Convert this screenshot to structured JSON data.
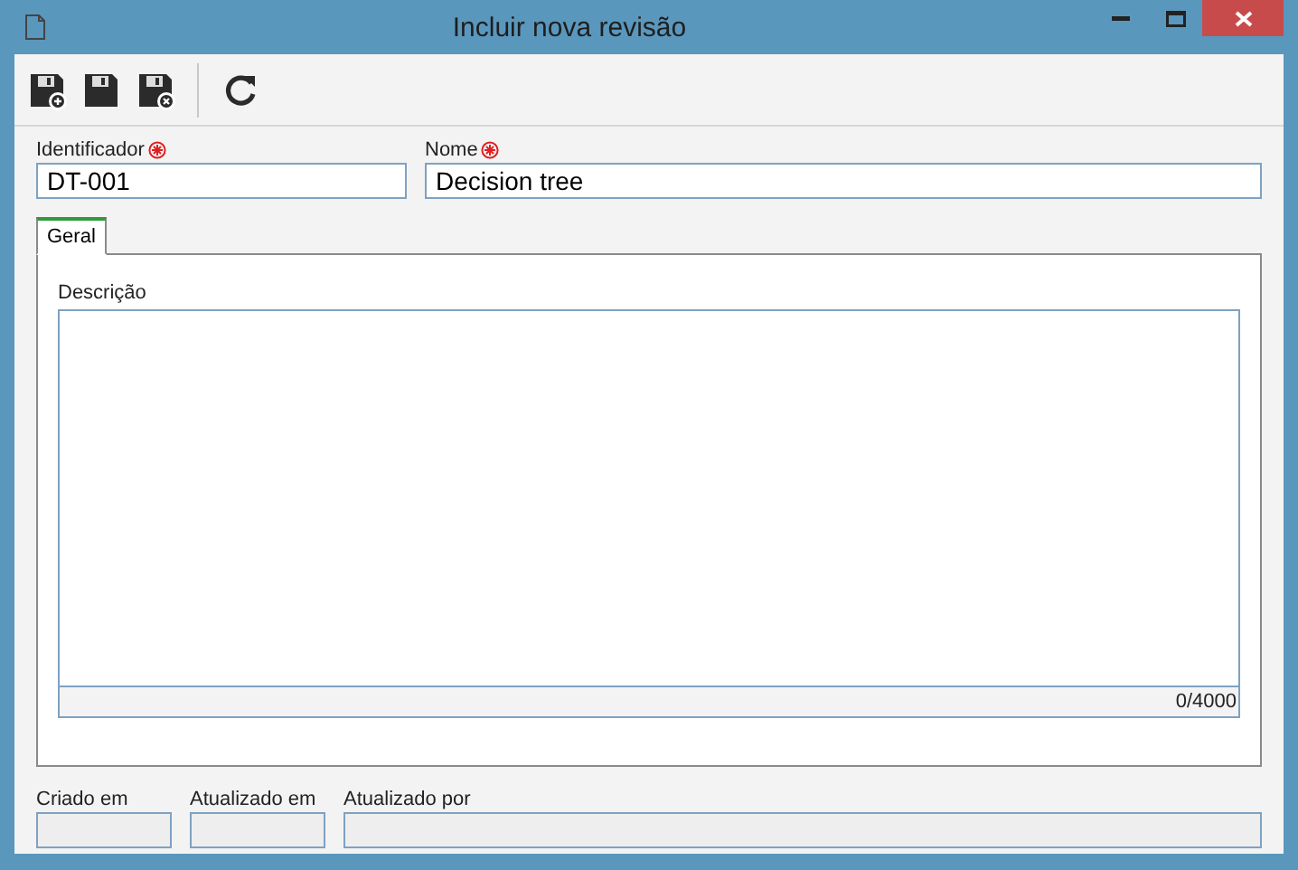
{
  "window": {
    "title": "Incluir nova revisão"
  },
  "toolbar": [
    {
      "kind": "save-new"
    },
    {
      "kind": "save"
    },
    {
      "kind": "save-close"
    },
    {
      "kind": "separator"
    },
    {
      "kind": "refresh"
    }
  ],
  "fields": [
    {
      "label": "Identificador",
      "required": true,
      "value": "DT-001"
    },
    {
      "label": "Nome",
      "required": true,
      "value": "Decision tree"
    }
  ],
  "tabs": [
    {
      "label": "Geral",
      "selected": true
    }
  ],
  "description": {
    "label": "Descrição",
    "counter": "0/4000"
  },
  "footer_fields": [
    {
      "label": "Criado em"
    },
    {
      "label": "Atualizado em"
    },
    {
      "label": "Atualizado por"
    }
  ]
}
